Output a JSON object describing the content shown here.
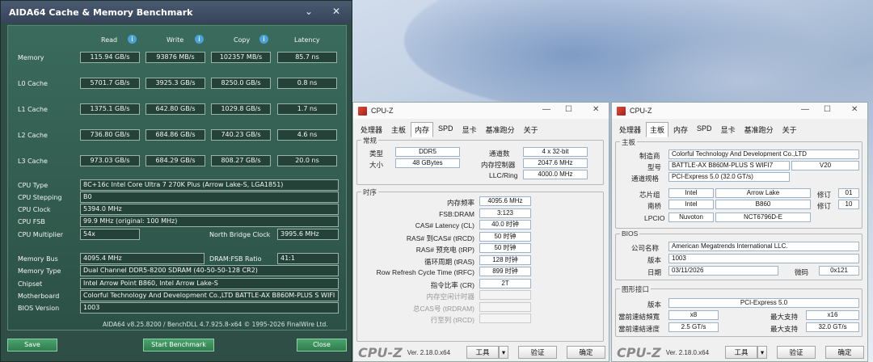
{
  "aida": {
    "title": "AIDA64 Cache & Memory Benchmark",
    "minimize": "⌄",
    "close": "✕",
    "headers": {
      "read": "Read",
      "write": "Write",
      "copy": "Copy",
      "latency": "Latency",
      "info": "i"
    },
    "rows": [
      {
        "label": "Memory",
        "read": "115.94 GB/s",
        "write": "93876 MB/s",
        "copy": "102357 MB/s",
        "latency": "85.7 ns"
      },
      {
        "label": "L0 Cache",
        "read": "5701.7 GB/s",
        "write": "3925.3 GB/s",
        "copy": "8250.0 GB/s",
        "latency": "0.8 ns"
      },
      {
        "label": "L1 Cache",
        "read": "1375.1 GB/s",
        "write": "642.80 GB/s",
        "copy": "1029.8 GB/s",
        "latency": "1.7 ns"
      },
      {
        "label": "L2 Cache",
        "read": "736.80 GB/s",
        "write": "684.86 GB/s",
        "copy": "740.23 GB/s",
        "latency": "4.6 ns"
      },
      {
        "label": "L3 Cache",
        "read": "973.03 GB/s",
        "write": "684.29 GB/s",
        "copy": "808.27 GB/s",
        "latency": "20.0 ns"
      }
    ],
    "cpu_type_label": "CPU Type",
    "cpu_type": "8C+16c Intel Core Ultra 7 270K Plus  (Arrow Lake-S, LGA1851)",
    "cpu_stepping_label": "CPU Stepping",
    "cpu_stepping": "B0",
    "cpu_clock_label": "CPU Clock",
    "cpu_clock": "5394.0 MHz",
    "cpu_fsb_label": "CPU FSB",
    "cpu_fsb": "99.9 MHz  (original: 100 MHz)",
    "cpu_mult_label": "CPU Multiplier",
    "cpu_mult": "54x",
    "nb_clock_label": "North Bridge Clock",
    "nb_clock": "3995.6 MHz",
    "mem_bus_label": "Memory Bus",
    "mem_bus": "4095.4 MHz",
    "dram_ratio_label": "DRAM:FSB Ratio",
    "dram_ratio": "41:1",
    "mem_type_label": "Memory Type",
    "mem_type": "Dual Channel DDR5-8200 SDRAM  (40-50-50-128 CR2)",
    "chipset_label": "Chipset",
    "chipset": "Intel Arrow Point B860, Intel Arrow Lake-S",
    "mobo_label": "Motherboard",
    "mobo": "Colorful Technology And Development Co.,LTD BATTLE-AX B860M-PLUS S WIFI",
    "bios_label": "BIOS Version",
    "bios": "1003",
    "footer": "AIDA64 v8.25.8200 / BenchDLL 4.7.925.8-x64  © 1995-2026 FinalWire Ltd.",
    "save": "Save",
    "start": "Start Benchmark",
    "close_btn": "Close"
  },
  "cpuz1": {
    "title": "CPU-Z",
    "ctl_min": "—",
    "ctl_max": "☐",
    "ctl_close": "✕",
    "tabs": [
      "处理器",
      "主板",
      "内存",
      "SPD",
      "显卡",
      "基准跑分",
      "关于"
    ],
    "general": "常规",
    "type_label": "类型",
    "type": "DDR5",
    "size_label": "大小",
    "size": "48 GBytes",
    "channels_label": "通道数",
    "channels": "4 x 32-bit",
    "mc_label": "内存控制器",
    "mc": "2047.6 MHz",
    "uncore_label": "LLC/Ring",
    "uncore": "4000.0 MHz",
    "timings": "时序",
    "rows": [
      {
        "label": "内存频率",
        "value": "4095.6 MHz"
      },
      {
        "label": "FSB:DRAM",
        "value": "3:123"
      },
      {
        "label": "CAS# Latency (CL)",
        "value": "40.0 时钟"
      },
      {
        "label": "RAS# 到CAS# (tRCD)",
        "value": "50 时钟"
      },
      {
        "label": "RAS# 预充电 (tRP)",
        "value": "50 时钟"
      },
      {
        "label": "循环周期 (tRAS)",
        "value": "128 时钟"
      },
      {
        "label": "Row Refresh Cycle Time (tRFC)",
        "value": "899 时钟"
      },
      {
        "label": "指令比率 (CR)",
        "value": "2T"
      }
    ],
    "grey_rows": [
      "内存空闲计时器",
      "总CAS号 (tRDRAM)",
      "行至列 (tRCD)"
    ],
    "logo": "CPU-Z",
    "version": "Ver. 2.18.0.x64",
    "tools": "工具",
    "validate": "验证",
    "ok": "确定"
  },
  "cpuz2": {
    "title": "CPU-Z",
    "ctl_min": "—",
    "ctl_max": "☐",
    "ctl_close": "✕",
    "tabs": [
      "处理器",
      "主板",
      "内存",
      "SPD",
      "显卡",
      "基准跑分",
      "关于"
    ],
    "mainboard": "主板",
    "mfr_label": "制造商",
    "mfr": "Colorful Technology And Development Co.,LTD",
    "model_label": "型号",
    "model": "BATTLE-AX B860M-PLUS S WIFI7",
    "model_rev": "V20",
    "bus_label": "通道规格",
    "bus": "PCI-Express 5.0 (32.0 GT/s)",
    "chipset_label": "芯片组",
    "chipset_v": "Intel",
    "chipset_n": "Arrow Lake",
    "rev_label": "修订",
    "chipset_rev": "01",
    "south_label": "南桥",
    "south_v": "Intel",
    "south_n": "B860",
    "south_rev": "10",
    "lpcio_label": "LPCIO",
    "lpcio_v": "Nuvoton",
    "lpcio_n": "NCT6796D-E",
    "bios": "BIOS",
    "brand_label": "公司名称",
    "brand": "American Megatrends International LLC.",
    "ver_label": "版本",
    "ver": "1003",
    "date_label": "日期",
    "date": "03/11/2026",
    "cpu_label": "微码",
    "cpu_code": "0x121",
    "graphic": "图形接口",
    "gver_label": "版本",
    "gver": "PCI-Express 5.0",
    "link_label": "當前連結頻寬",
    "link": "x8",
    "max_label": "最大支持",
    "max_link": "x16",
    "speed_label": "當前連結速度",
    "speed": "2.5 GT/s",
    "max_speed": "32.0 GT/s",
    "logo": "CPU-Z",
    "version": "Ver. 2.18.0.x64",
    "tools": "工具",
    "validate": "验证",
    "ok": "确定"
  }
}
